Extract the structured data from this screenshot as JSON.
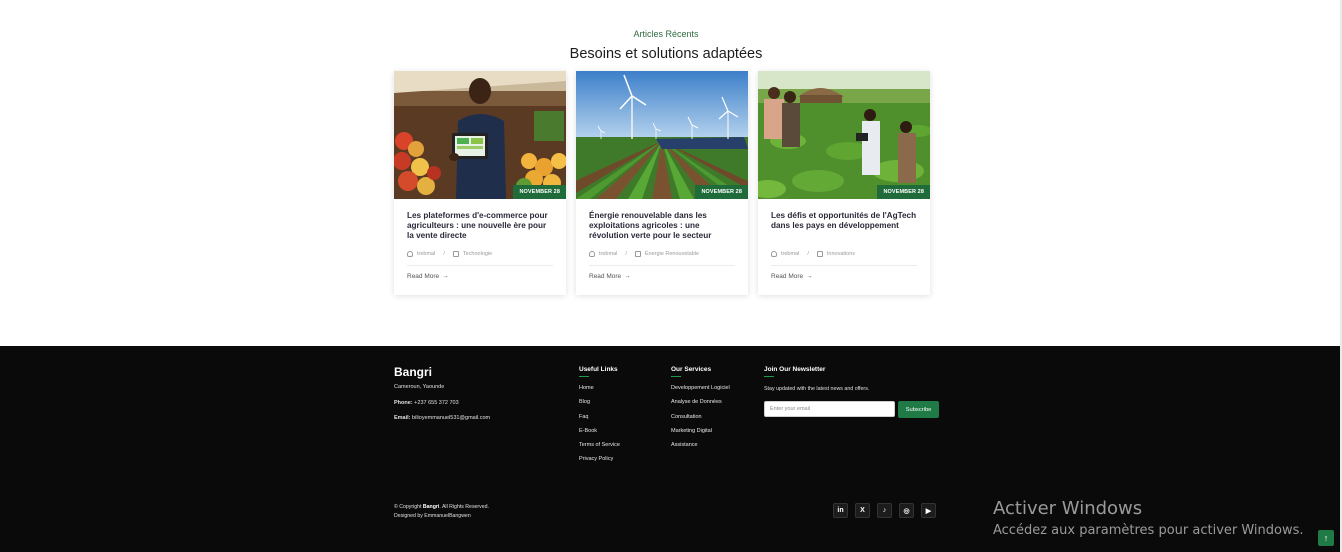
{
  "recent": {
    "eyebrow": "Articles Récents",
    "title": "Besoins et solutions adaptées",
    "read_more_label": "Read More",
    "cards": [
      {
        "image": "market-farmer-tablet-photo",
        "date": "NOVEMBER 28",
        "title": "Les plateformes d'e-commerce pour agriculteurs : une nouvelle ère pour la vente directe",
        "author": "trebmal",
        "category": "Technologie"
      },
      {
        "image": "wind-turbines-solar-farm-photo",
        "date": "NOVEMBER 28",
        "title": "Énergie renouvelable dans les exploitations agricoles : une révolution verte pour le secteur",
        "author": "trebmal",
        "category": "Énergie Renouvelable"
      },
      {
        "image": "farmers-field-tablet-photo",
        "date": "NOVEMBER 28",
        "title": "Les défis et opportunités de l'AgTech dans les pays en développement",
        "author": "trebmal",
        "category": "Innovations"
      }
    ]
  },
  "footer": {
    "brand": "Bangri",
    "location": "Cameroun, Yaounde",
    "phone_label": "Phone:",
    "phone": "+237 655 372 703",
    "email_label": "Email:",
    "email": "bilioyemmanuel531@gmail.com",
    "useful_links": {
      "heading": "Useful Links",
      "items": [
        "Home",
        "Blog",
        "Faq",
        "E-Book",
        "Terms of Service",
        "Privacy Policy"
      ]
    },
    "services": {
      "heading": "Our Services",
      "items": [
        "Developpement Logiciel",
        "Analyse de Données",
        "Consultation",
        "Marketing Digital",
        "Assistance"
      ]
    },
    "newsletter": {
      "heading": "Join Our Newsletter",
      "text": "Stay updated with the latest news and offers.",
      "placeholder": "Enter your email",
      "button": "Subscribe"
    },
    "copyright_prefix": "© Copyright",
    "copyright_brand": "Bangri",
    "copyright_suffix": ". All Rights Reserved.",
    "designed_by": "Designed by EmmanuelBangwen",
    "socials": [
      {
        "icon": "linkedin-icon",
        "glyph": "in"
      },
      {
        "icon": "x-icon",
        "glyph": "X"
      },
      {
        "icon": "tiktok-icon",
        "glyph": "♪"
      },
      {
        "icon": "instagram-icon",
        "glyph": "◎"
      },
      {
        "icon": "youtube-icon",
        "glyph": "▶"
      }
    ]
  },
  "windows_watermark": {
    "title": "Activer Windows",
    "subtitle": "Accédez aux paramètres pour activer Windows."
  },
  "back_to_top": {
    "icon": "arrow-up-icon",
    "glyph": "↑"
  },
  "colors": {
    "accent": "#1f7a45",
    "footer_bg": "#0a0a0a"
  }
}
